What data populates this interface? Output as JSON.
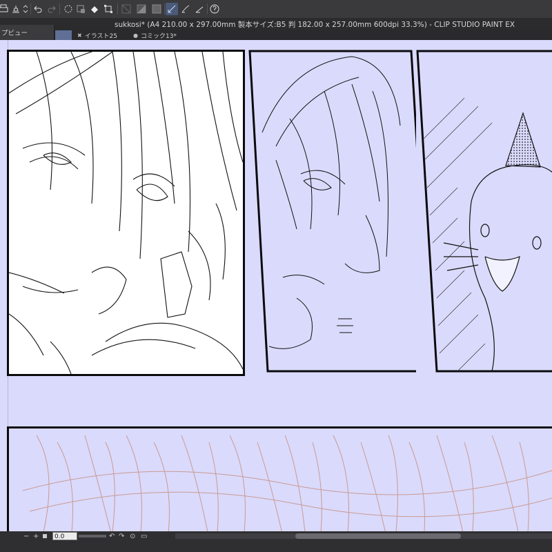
{
  "window": {
    "title": "sukkosi* (A4 210.00 x 297.00mm 製本サイズ:B5 判 182.00 x 257.00mm 600dpi 33.3%)  - CLIP STUDIO PAINT EX"
  },
  "side_panel": {
    "label": "プビュー"
  },
  "tabs": [
    {
      "label": "イラスト25",
      "icon": "close-icon",
      "glyph": "✖"
    },
    {
      "label": "コミック13*",
      "icon": "unsaved-dot-icon",
      "glyph": "●"
    }
  ],
  "toolbar": {
    "tools": [
      "print-icon",
      "undo-icon",
      "redo-icon",
      "loading-icon",
      "selection-launcher-icon",
      "fill-icon",
      "transform-icon",
      "clear-icon",
      "fill-selection-icon",
      "invert-icon",
      "pen-icon",
      "pencil-icon",
      "brush-icon",
      "help-icon"
    ]
  },
  "statusbar": {
    "zoom_value": "0.0",
    "minus_glyph": "−",
    "plus_glyph": "+"
  },
  "colors": {
    "canvas": "#dadafc",
    "panel_border": "#0b0b0e",
    "sketch_lines": "#c99a92",
    "active_tab": "#5f6f95"
  }
}
